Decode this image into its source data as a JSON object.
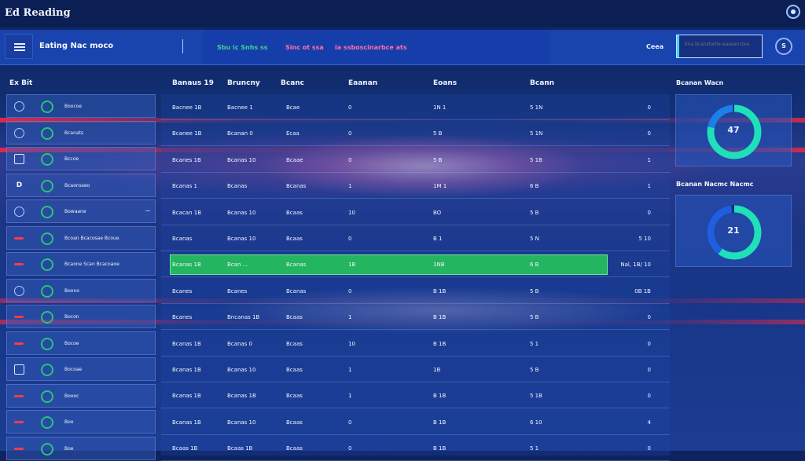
{
  "app": {
    "title": "Ed Reading"
  },
  "nav": {
    "title": "Eating Nac moco",
    "links": [
      {
        "label": "Sbu ic Snhs ss",
        "color": "green"
      },
      {
        "label": "Sinc ot ssa",
        "color": "pink"
      },
      {
        "label": "ia ssboscinarbce ats",
        "color": "pink"
      }
    ],
    "right_label": "Ceea",
    "search": {
      "value": "",
      "placeholder": "Ena bcanstwtie eaaesnctea"
    },
    "avatar": "S"
  },
  "left": {
    "header": "Ex Bit",
    "items": [
      {
        "icon": "ring",
        "label": "Boocoe"
      },
      {
        "icon": "ring",
        "label": "Bcanats"
      },
      {
        "icon": "square",
        "label": "Bccoe"
      },
      {
        "icon": "d",
        "label": "Bcaonsseo"
      },
      {
        "icon": "ring",
        "label": "Bowaane"
      },
      {
        "icon": "red",
        "label": "Bcoan Bcacosae Bcoue"
      },
      {
        "icon": "red",
        "label": "Bcaone Scan Bcacoaoe"
      },
      {
        "icon": "ring",
        "label": "Boono"
      },
      {
        "icon": "red",
        "label": "Bocon"
      },
      {
        "icon": "red",
        "label": "Bocoe"
      },
      {
        "icon": "square",
        "label": "Bocoae"
      },
      {
        "icon": "red",
        "label": "Boooc"
      },
      {
        "icon": "red",
        "label": "Boo"
      },
      {
        "icon": "red",
        "label": "Boe"
      }
    ]
  },
  "table": {
    "headers": [
      "Banaus 19",
      "Bruncny",
      "Bcanc",
      "Eaanan",
      "Eoans",
      "Bcann"
    ],
    "rows": [
      [
        "Bacnee 1B",
        "Bacnee 1",
        "Bcae",
        "0",
        "1N 1",
        "5 1N",
        "0"
      ],
      [
        "Bcanee 1B",
        "Bcanan 0",
        "Ecaa",
        "0",
        "5 B",
        "5 1N",
        "0"
      ],
      [
        "Bcanes 1B",
        "Bcanas 10",
        "Bcaae",
        "0",
        "5 B",
        "5 1B",
        "1"
      ],
      [
        "Bcanas 1",
        "Bcanas",
        "Bcanas",
        "1",
        "1M 1",
        "6 B",
        "1"
      ],
      [
        "Bcacan 1B",
        "Bcanas 10",
        "Bcaas",
        "10",
        "BO",
        "5 B",
        "0"
      ],
      [
        "Bcanas",
        "Bcanas 10",
        "Bcaas",
        "0",
        "B 1",
        "5 N",
        "5 10"
      ],
      [
        "Bcanas 1B",
        "Bcan ...",
        "Bcanas",
        "1B",
        "1NB",
        "6 B",
        "Nal, 1B/ 10"
      ],
      [
        "Bcanes",
        "Bcanes",
        "Bcanas",
        "0",
        "B 1B",
        "5 B",
        "0B 1B"
      ],
      [
        "Bcanes",
        "Bncanas 1B",
        "Bcaas",
        "1",
        "B 1B",
        "5 B",
        "0"
      ],
      [
        "Bcanas 1B",
        "Bcanas 0",
        "Bcaas",
        "10",
        "B 1B",
        "5 1",
        "0"
      ],
      [
        "Bcanas 1B",
        "Bcanas 10",
        "Bcaas",
        "1",
        "1B",
        "5 B",
        "0"
      ],
      [
        "Bcanas 1B",
        "Bcanas 1B",
        "Bcaas",
        "1",
        "B 1B",
        "5 1B",
        "0"
      ],
      [
        "Bcanas 1B",
        "Bcanas 10",
        "Bcaas",
        "0",
        "B 1B",
        "6 10",
        "4"
      ],
      [
        "Bcaas 1B",
        "Bcaas 1B",
        "Bcaas",
        "0",
        "B 1B",
        "5 1",
        "0"
      ]
    ]
  },
  "side": {
    "cards": [
      {
        "title": "Bcanan Wacn",
        "value": "47",
        "ring_fraction": 0.78,
        "colors": [
          "#1fe0b8",
          "#1e7fe8"
        ]
      },
      {
        "title": "Bcanan Nacmc Nacmc",
        "value": "21",
        "ring_fraction": 0.6,
        "colors": [
          "#1fe0b8",
          "#1e5fe0"
        ]
      }
    ]
  },
  "colors": {
    "accent": "#24b561",
    "brand": "#1a46b4",
    "alert": "#ff3a4a"
  }
}
